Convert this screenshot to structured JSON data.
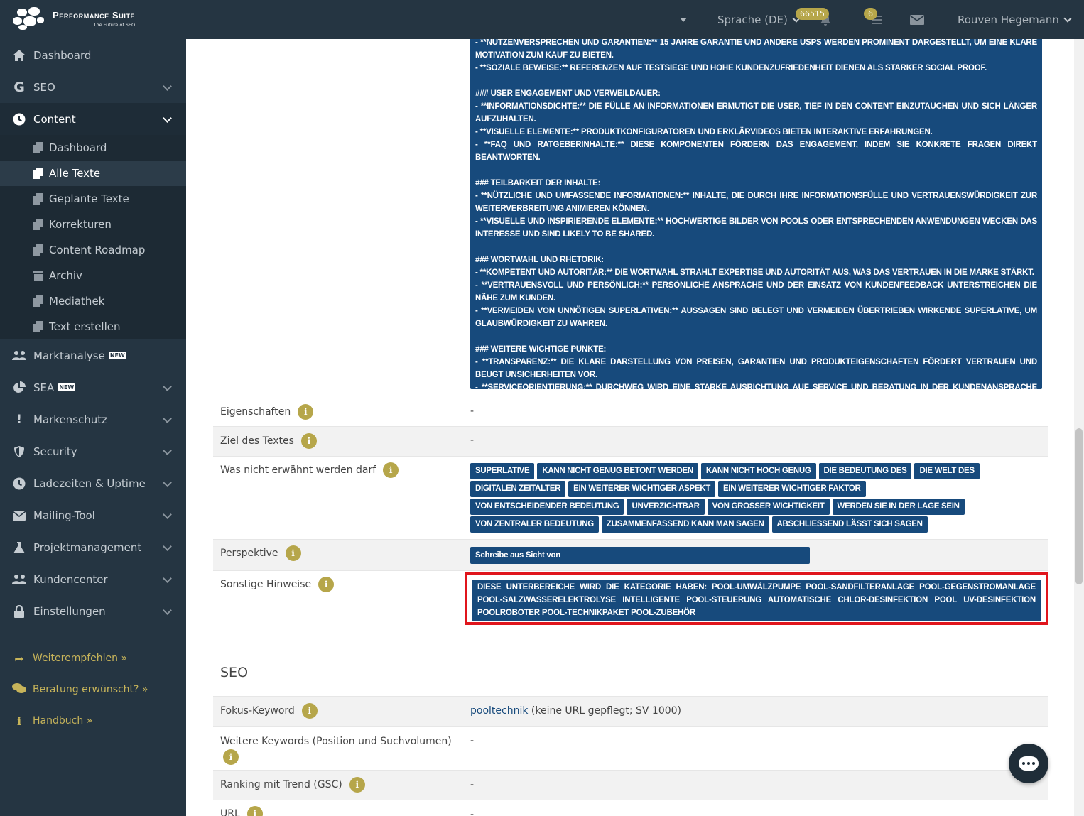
{
  "brand": {
    "name": "Performance Suite",
    "tagline": "The Future of SEO"
  },
  "topbar": {
    "language": "Sprache (DE)",
    "badge_count": "66515",
    "notif_count": "6",
    "user": "Rouven Hegemann"
  },
  "sidebar": {
    "items": [
      {
        "label": "Dashboard",
        "icon": "home-icon"
      },
      {
        "label": "SEO",
        "icon": "google-icon"
      },
      {
        "label": "Content",
        "icon": "clock-icon"
      },
      {
        "label": "Marktanalyse",
        "icon": "users-icon",
        "badge": "NEW"
      },
      {
        "label": "SEA",
        "icon": "pie-chart-icon",
        "badge": "NEW"
      },
      {
        "label": "Markenschutz",
        "icon": "exclamation-icon"
      },
      {
        "label": "Security",
        "icon": "shield-icon"
      },
      {
        "label": "Ladezeiten & Uptime",
        "icon": "clock-icon"
      },
      {
        "label": "Mailing-Tool",
        "icon": "envelope-icon"
      },
      {
        "label": "Projektmanagement",
        "icon": "flask-icon"
      },
      {
        "label": "Kundencenter",
        "icon": "users-icon"
      },
      {
        "label": "Einstellungen",
        "icon": "lock-icon"
      }
    ],
    "content_sub": [
      {
        "label": "Dashboard"
      },
      {
        "label": "Alle Texte"
      },
      {
        "label": "Geplante Texte"
      },
      {
        "label": "Korrekturen"
      },
      {
        "label": "Content Roadmap"
      },
      {
        "label": "Archiv"
      },
      {
        "label": "Mediathek"
      },
      {
        "label": "Text erstellen"
      }
    ],
    "extras": [
      {
        "label": "Weiterempfehlen »",
        "icon": "share-icon"
      },
      {
        "label": "Beratung erwünscht? »",
        "icon": "comments-icon"
      },
      {
        "label": "Handbuch »",
        "icon": "info-icon"
      }
    ]
  },
  "analysis": {
    "lines": [
      "- **Nutzenversprechen und Garantien:** 15 Jahre Garantie und andere USPs werden prominent dargestellt, um eine klare Motivation zum Kauf zu bieten.",
      "- **Soziale Beweise:** Referenzen auf Testsiege und hohe Kundenzufriedenheit dienen als starker Social Proof.",
      "",
      "### User Engagement und Verweildauer:",
      "- **Informationsdichte:** Die Fülle an Informationen ermutigt die User, tief in den Content einzutauchen und sich länger aufzuhalten.",
      "- **Visuelle Elemente:** Produktkonfiguratoren und Erklärvideos bieten interaktive Erfahrungen.",
      "- **FAQ und Ratgeberinhalte:** Diese Komponenten fördern das Engagement, indem sie konkrete Fragen direkt beantworten.",
      "",
      "### Teilbarkeit der Inhalte:",
      "- **Nützliche und umfassende Informationen:** Inhalte, die durch ihre Informationsfülle und Vertrauenswürdigkeit zur Weiterverbreitung animieren können.",
      "- **Visuelle und inspirierende Elemente:** Hochwertige Bilder von Pools oder entsprechenden Anwendungen wecken das Interesse und sind likely to be shared.",
      "",
      "### Wortwahl und Rhetorik:",
      "- **Kompetent und autoritär:** Die Wortwahl strahlt Expertise und Autorität aus, was das Vertrauen in die Marke stärkt.",
      "- **Vertrauensvoll und persönlich:** Persönliche Ansprache und der Einsatz von Kundenfeedback unterstreichen die Nähe zum Kunden.",
      "- **Vermeiden von unnötigen Superlativen:** Aussagen sind belegt und vermeiden übertrieben wirkende Superlative, um Glaubwürdigkeit zu wahren.",
      "",
      "### Weitere wichtige Punkte:",
      "- **Transparenz:** Die klare Darstellung von Preisen, Garantien und Produkteigenschaften fördert Vertrauen und beugt Unsicherheiten vor.",
      "- **Serviceorientierung:** Durchweg wird eine starke Ausrichtung auf Service und Beratung in der Kundenansprache betont."
    ]
  },
  "rows": {
    "eigenschaften": {
      "label": "Eigenschaften",
      "value": "-"
    },
    "ziel": {
      "label": "Ziel des Textes",
      "value": "-"
    },
    "verbote": {
      "label": "Was nicht erwähnt werden darf"
    },
    "perspektive": {
      "label": "Perspektive",
      "value": "Schreibe aus Sicht von"
    },
    "hinweise": {
      "label": "Sonstige Hinweise",
      "value": "Diese Unterbereiche wird die Kategorie haben: Pool-Umwälzpumpe Pool-Sandfilteranlage Pool-Gegenstromanlage Pool-Salzwasserelektrolyse Intelligente Pool-Steuerung Automatische Chlor-Desinfektion Pool UV-Desinfektion Poolroboter Pool-Technikpaket Pool-Zubehör"
    }
  },
  "forbidden_tags": [
    "Superlative",
    "kann nicht genug betont werden",
    "kann nicht hoch genug",
    "die Bedeutung des",
    "die Welt des",
    "digitalen Zeitalter",
    "ein weiterer wichtiger Aspekt",
    "ein weiterer wichtiger Faktor",
    "von entscheidender Bedeutung",
    "unverzichtbar",
    "von großer Wichtigkeit",
    "werden Sie in der Lage sein",
    "von zentraler Bedeutung",
    "zusammenfassend kann man sagen",
    "abschließend lässt sich sagen"
  ],
  "seo": {
    "title": "SEO",
    "fokus": {
      "label": "Fokus-Keyword",
      "keyword": "pooltechnik",
      "suffix": "(keine URL gepflegt; SV 1000)"
    },
    "weitere": {
      "label": "Weitere Keywords (Position und Suchvolumen)",
      "value": "-"
    },
    "ranking": {
      "label": "Ranking mit Trend (GSC)",
      "value": "-"
    },
    "url": {
      "label": "URL",
      "value": "-"
    }
  }
}
